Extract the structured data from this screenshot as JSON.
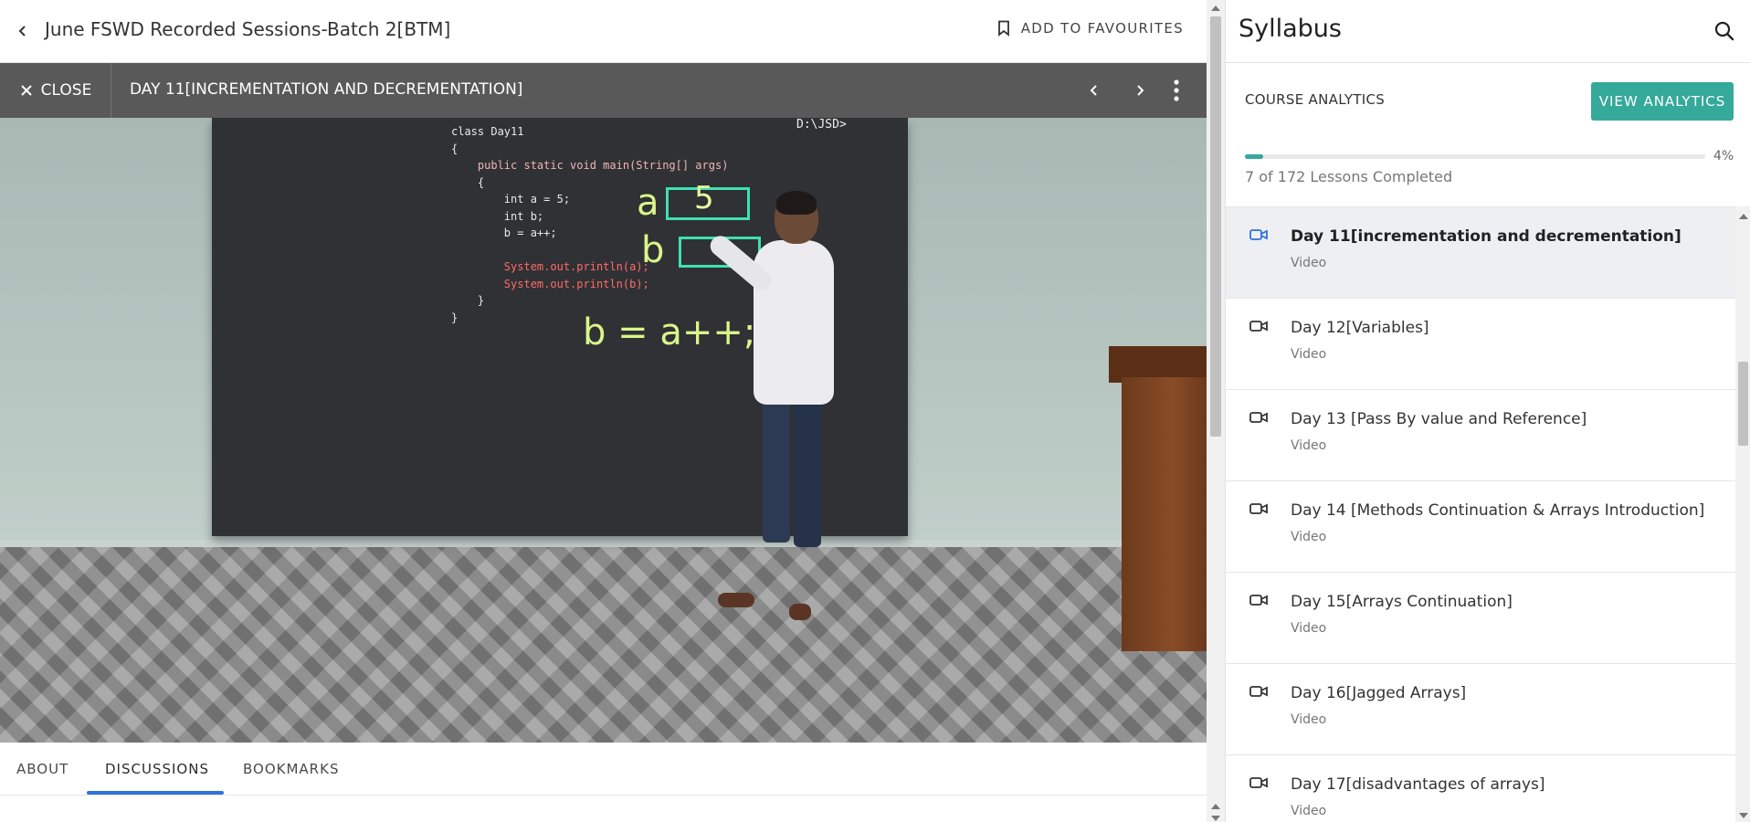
{
  "header": {
    "course_title": "June FSWD Recorded Sessions-Batch 2[BTM]",
    "favourites_label": "ADD TO FAVOURITES"
  },
  "video_bar": {
    "close_label": "CLOSE",
    "lesson_title": "DAY 11[INCREMENTATION AND DECREMENTATION]"
  },
  "video_frame": {
    "prompt": "D:\\JSD>",
    "code_lines": [
      "class Day11",
      "{",
      "    public static void main(String[] args)",
      "    {",
      "        int a = 5;",
      "        int b;",
      "        b = a++;",
      "",
      "        System.out.println(a);",
      "        System.out.println(b);",
      "    }",
      "}"
    ],
    "chalk_a": "a",
    "chalk_a_value": "5",
    "chalk_b": "b",
    "chalk_expr": "b = a++;"
  },
  "tabs": [
    {
      "label": "ABOUT",
      "active": false
    },
    {
      "label": "DISCUSSIONS",
      "active": true
    },
    {
      "label": "BOOKMARKS",
      "active": false
    }
  ],
  "syllabus": {
    "title": "Syllabus",
    "analytics_label": "COURSE ANALYTICS",
    "analytics_button": "VIEW ANALYTICS",
    "progress_percent": 4,
    "progress_percent_label": "4%",
    "progress_text": "7 of 172 Lessons Completed",
    "lessons": [
      {
        "title": "Day 11[incrementation and decrementation]",
        "type": "Video",
        "active": true
      },
      {
        "title": "Day 12[Variables]",
        "type": "Video",
        "active": false
      },
      {
        "title": "Day 13 [Pass By value and Reference]",
        "type": "Video",
        "active": false
      },
      {
        "title": "Day 14 [Methods Continuation & Arrays Introduction]",
        "type": "Video",
        "active": false
      },
      {
        "title": "Day 15[Arrays Continuation]",
        "type": "Video",
        "active": false
      },
      {
        "title": "Day 16[Jagged Arrays]",
        "type": "Video",
        "active": false
      },
      {
        "title": "Day 17[disadvantages of arrays]",
        "type": "Video",
        "active": false
      }
    ]
  },
  "colors": {
    "accent": "#35a99a",
    "active_tab": "#2f72dd",
    "video_bar": "#595959",
    "active_lesson_bg": "#edeff2",
    "active_lesson_icon": "#2f72dd"
  },
  "icons": {
    "back": "chevron-left-icon",
    "favourite": "bookmark-icon",
    "close": "close-icon",
    "prev": "chevron-left-icon",
    "next": "chevron-right-icon",
    "more": "more-vertical-icon",
    "search": "search-icon",
    "lesson": "video-camera-icon"
  }
}
